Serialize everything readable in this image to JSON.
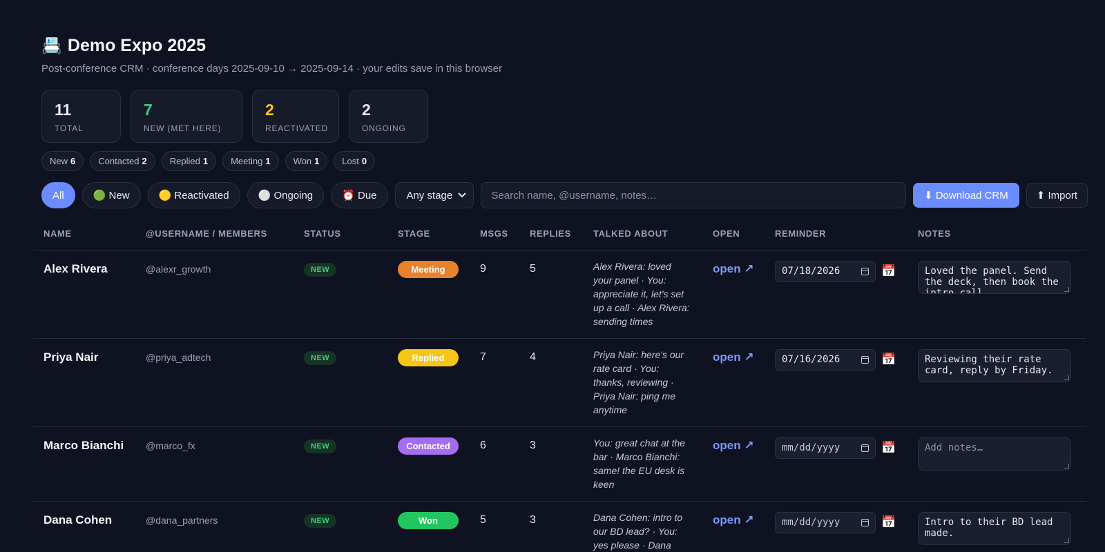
{
  "header": {
    "icon": "📇",
    "title": "Demo Expo 2025",
    "subtitle": "Post-conference CRM · conference days 2025-09-10 → 2025-09-14 · your edits save in this browser"
  },
  "stats": [
    {
      "value": "11",
      "label": "TOTAL",
      "color": "#f4f5f8"
    },
    {
      "value": "7",
      "label": "NEW (MET HERE)",
      "color": "#3ccf7a"
    },
    {
      "value": "2",
      "label": "REACTIVATED",
      "color": "#f5c518"
    },
    {
      "value": "2",
      "label": "ONGOING",
      "color": "#f4f5f8"
    }
  ],
  "stage_counts": [
    {
      "label": "New",
      "count": "6"
    },
    {
      "label": "Contacted",
      "count": "2"
    },
    {
      "label": "Replied",
      "count": "1"
    },
    {
      "label": "Meeting",
      "count": "1"
    },
    {
      "label": "Won",
      "count": "1"
    },
    {
      "label": "Lost",
      "count": "0"
    }
  ],
  "filters": {
    "all": "All",
    "new": "🟢 New",
    "reactivated": "🟡 Reactivated",
    "ongoing": "⚪ Ongoing",
    "due": "⏰ Due",
    "stage_select": "Any stage",
    "search_placeholder": "Search name, @username, notes…",
    "download": "⬇ Download CRM",
    "import": "⬆ Import"
  },
  "table": {
    "columns": [
      "NAME",
      "@USERNAME / MEMBERS",
      "STATUS",
      "STAGE",
      "MSGS",
      "REPLIES",
      "TALKED ABOUT",
      "OPEN",
      "REMINDER",
      "NOTES"
    ],
    "rows": [
      {
        "name": "Alex Rivera",
        "username": "@alexr_growth",
        "status": "NEW",
        "stage": "Meeting",
        "stage_color": "#e8822a",
        "msgs": "9",
        "replies": "5",
        "talked": "Alex Rivera: loved your panel · You: appreciate it, let's set up a call · Alex Rivera: sending times",
        "open": "open ↗",
        "reminder": "07/18/2026",
        "notes": "Loved the panel. Send the deck, then book the intro call."
      },
      {
        "name": "Priya Nair",
        "username": "@priya_adtech",
        "status": "NEW",
        "stage": "Replied",
        "stage_color": "#f5c518",
        "msgs": "7",
        "replies": "4",
        "talked": "Priya Nair: here's our rate card · You: thanks, reviewing · Priya Nair: ping me anytime",
        "open": "open ↗",
        "reminder": "07/16/2026",
        "notes": "Reviewing their rate card, reply by Friday."
      },
      {
        "name": "Marco Bianchi",
        "username": "@marco_fx",
        "status": "NEW",
        "stage": "Contacted",
        "stage_color": "#a46cf0",
        "msgs": "6",
        "replies": "3",
        "talked": "You: great chat at the bar · Marco Bianchi: same! the EU desk is keen",
        "open": "open ↗",
        "reminder": "mm/dd/yyyy",
        "notes": "",
        "notes_placeholder": "Add notes…"
      },
      {
        "name": "Dana Cohen",
        "username": "@dana_partners",
        "status": "NEW",
        "stage": "Won",
        "stage_color": "#22c55e",
        "msgs": "5",
        "replies": "3",
        "talked": "Dana Cohen: intro to our BD lead? · You: yes please · Dana",
        "open": "open ↗",
        "reminder": "mm/dd/yyyy",
        "notes": "Intro to their BD lead made."
      }
    ]
  }
}
